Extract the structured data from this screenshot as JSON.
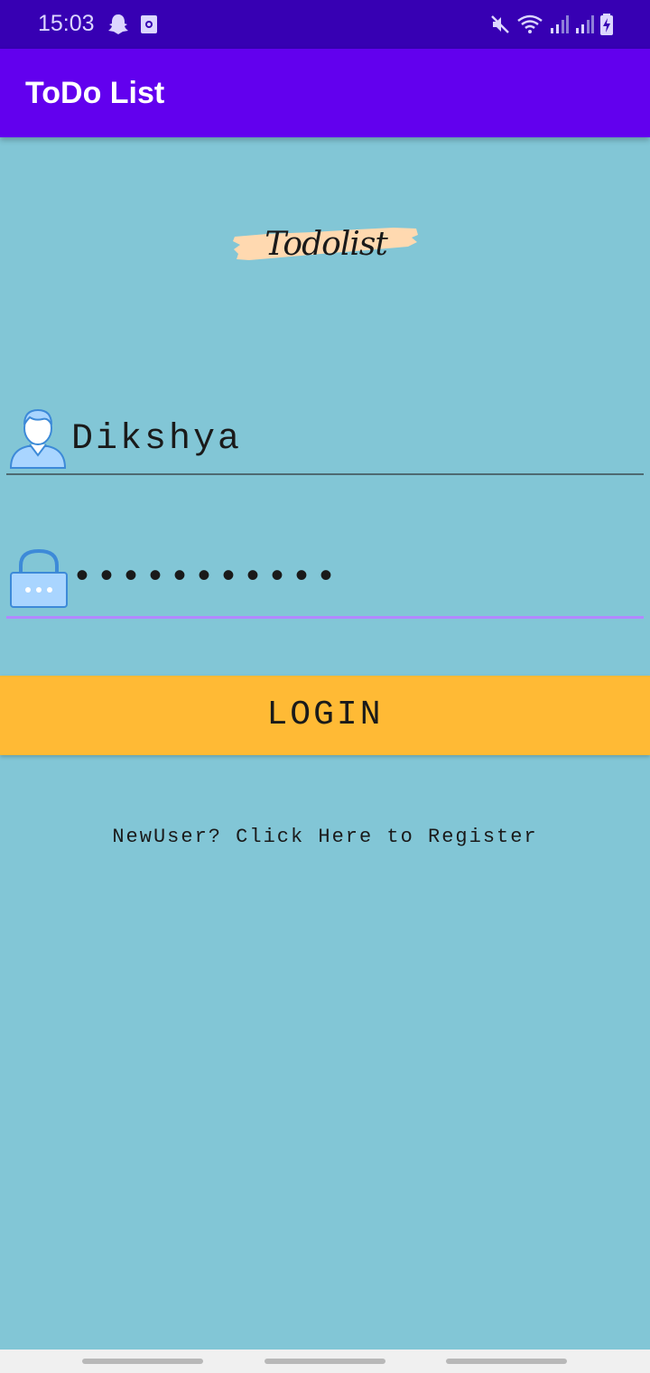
{
  "status_bar": {
    "time": "15:03",
    "left_icons": [
      "snapchat-icon",
      "screenshot-icon"
    ],
    "right_icons": [
      "mute-icon",
      "wifi-icon",
      "signal-icon",
      "signal-icon",
      "battery-charging-icon"
    ]
  },
  "app_bar": {
    "title": "ToDo List"
  },
  "logo": {
    "text": "Todolist"
  },
  "login_form": {
    "username_value": "Dikshya",
    "password_value": "•••••••••••",
    "login_label": "LOGIN"
  },
  "register_link": "NewUser? Click Here to Register",
  "colors": {
    "status_bar": "#3700B3",
    "app_bar": "#6200EE",
    "background": "#82C6D6",
    "button": "#FFBA35",
    "password_underline": "#B388FF",
    "logo_brush": "#FFD9B0"
  }
}
